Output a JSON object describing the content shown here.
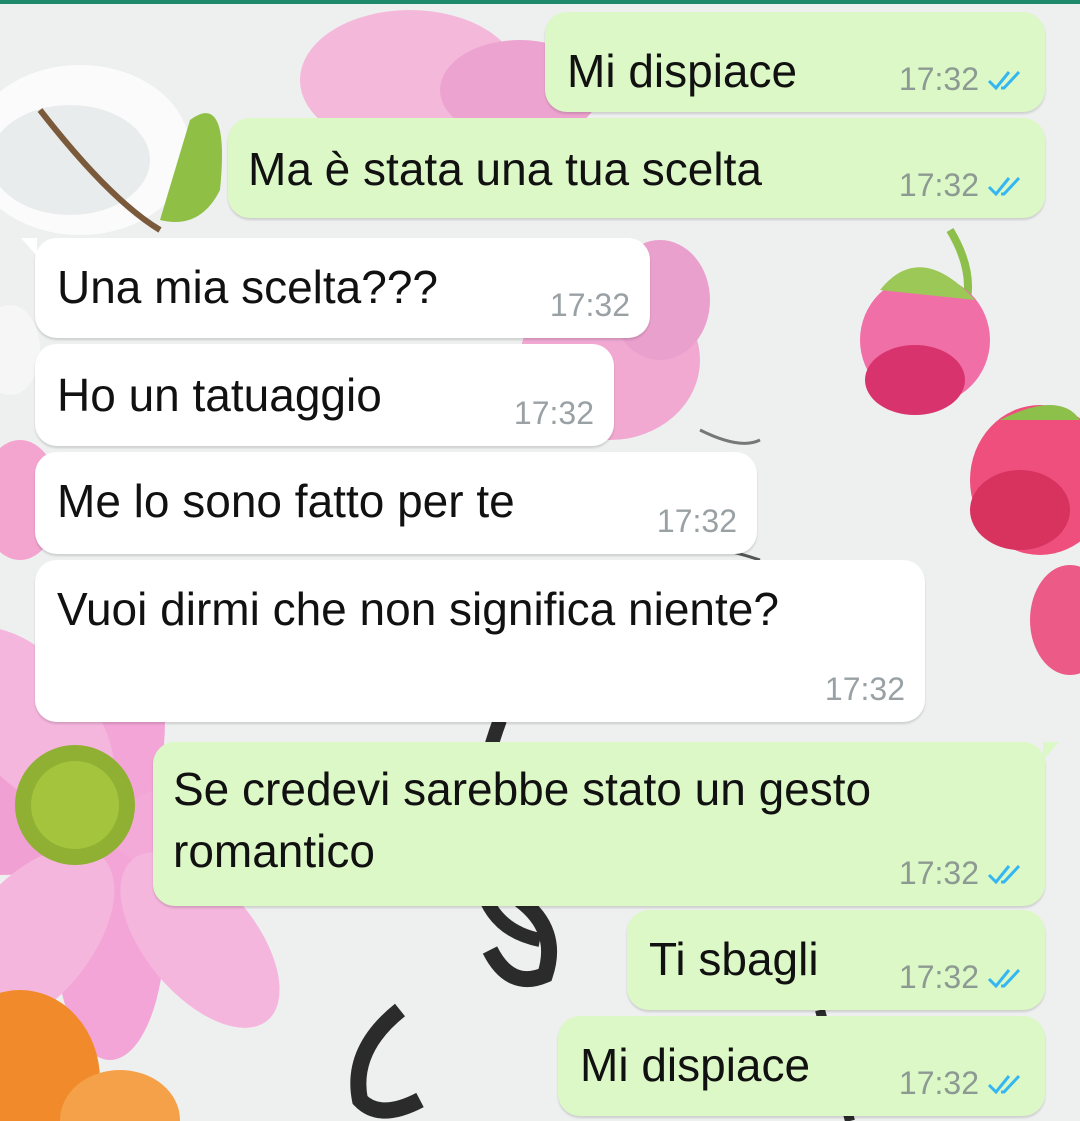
{
  "colors": {
    "outgoing_bubble": "#dcf8c6",
    "incoming_bubble": "#ffffff",
    "read_ticks": "#34b7f1",
    "timestamp": "#8d9a93"
  },
  "messages": [
    {
      "direction": "outgoing",
      "text": "Mi dispiace",
      "time": "17:32",
      "status": "read-double-check-icon"
    },
    {
      "direction": "outgoing",
      "text": "Ma è stata una tua scelta",
      "time": "17:32",
      "status": "read-double-check-icon"
    },
    {
      "direction": "incoming",
      "text": "Una mia scelta???",
      "time": "17:32"
    },
    {
      "direction": "incoming",
      "text": "Ho un tatuaggio",
      "time": "17:32"
    },
    {
      "direction": "incoming",
      "text": "Me lo sono fatto per te",
      "time": "17:32"
    },
    {
      "direction": "incoming",
      "text": "Vuoi dirmi che non significa niente?",
      "time": "17:32"
    },
    {
      "direction": "outgoing",
      "text": "Se credevi sarebbe stato un gesto romantico",
      "time": "17:32",
      "status": "read-double-check-icon"
    },
    {
      "direction": "outgoing",
      "text": "Ti sbagli",
      "time": "17:32",
      "status": "read-double-check-icon"
    },
    {
      "direction": "outgoing",
      "text": "Mi dispiace",
      "time": "17:32",
      "status": "read-double-check-icon"
    }
  ]
}
